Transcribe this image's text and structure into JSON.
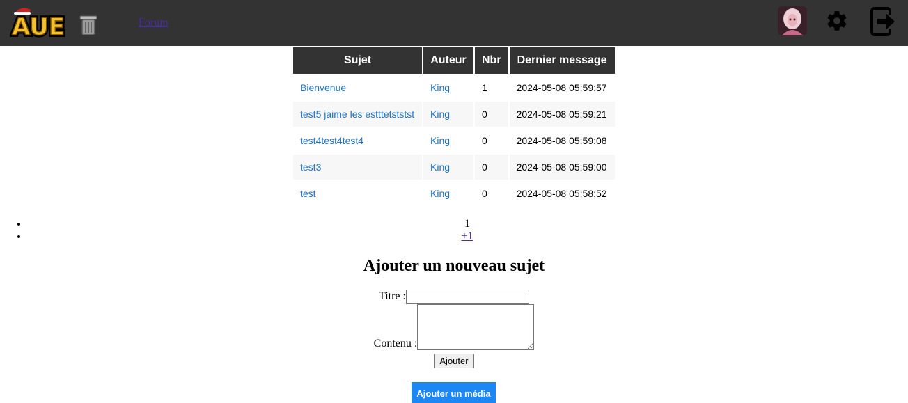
{
  "header": {
    "logo_text": "AUE",
    "nav_link": "Forum"
  },
  "table": {
    "columns": [
      "Sujet",
      "Auteur",
      "Nbr",
      "Dernier message"
    ],
    "rows": [
      {
        "subject": "Bienvenue",
        "author": "King",
        "count": "1",
        "last": "2024-05-08 05:59:57"
      },
      {
        "subject": "test5 jaime les estttetststst",
        "author": "King",
        "count": "0",
        "last": "2024-05-08 05:59:21"
      },
      {
        "subject": "test4test4test4",
        "author": "King",
        "count": "0",
        "last": "2024-05-08 05:59:08"
      },
      {
        "subject": "test3",
        "author": "King",
        "count": "0",
        "last": "2024-05-08 05:59:00"
      },
      {
        "subject": "test",
        "author": "King",
        "count": "0",
        "last": "2024-05-08 05:58:52"
      }
    ]
  },
  "pagination": {
    "current": "1",
    "next": "+1"
  },
  "form": {
    "heading": "Ajouter un nouveau sujet",
    "title_label": "Titre :",
    "title_value": "",
    "content_label": "Contenu :",
    "content_value": "",
    "submit_label": "Ajouter",
    "media_button_label": "Ajouter un média"
  },
  "colors": {
    "topbar": "#333333",
    "link": "#1b73c9",
    "primary_button": "#1c86f2"
  }
}
